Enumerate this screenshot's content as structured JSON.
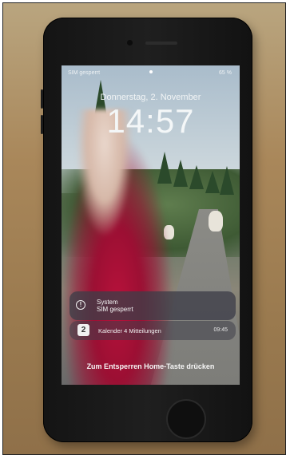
{
  "status_bar": {
    "carrier": "SIM gesperrt",
    "battery": "65 %"
  },
  "lock_screen": {
    "date": "Donnerstag, 2. November",
    "time": "14:57"
  },
  "notifications": [
    {
      "app": "System",
      "message": "SIM gesperrt"
    },
    {
      "icon_text": "2",
      "message": "Kalender 4 Mitteilungen",
      "time": "09:45"
    }
  ],
  "unlock_hint": "Zum Entsperren Home-Taste drücken"
}
